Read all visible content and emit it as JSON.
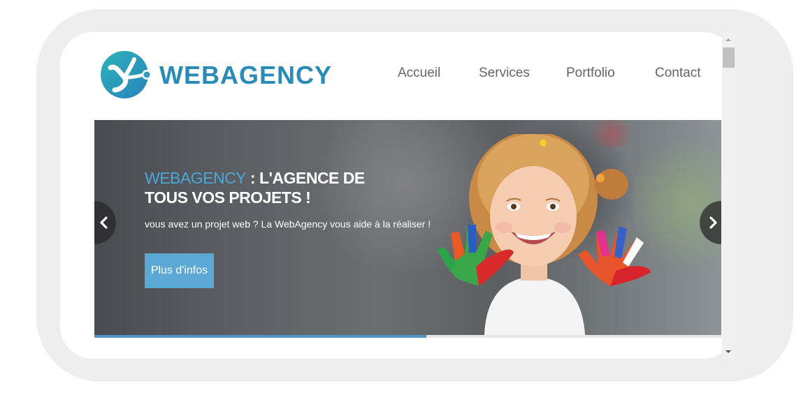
{
  "site": {
    "brand": "WEBAGENCY",
    "logo_icon": "webagency-logo-icon"
  },
  "nav": {
    "items": [
      {
        "label": "Accueil"
      },
      {
        "label": "Services"
      },
      {
        "label": "Portfolio"
      },
      {
        "label": "Contact"
      }
    ]
  },
  "hero": {
    "headline_accent": "WEBAGENCY",
    "headline_rest": " : L'AGENCE DE TOUS VOS PROJETS !",
    "subtitle": "vous avez un projet web ? La WebAgency vous aide à la réaliser !",
    "cta_label": "Plus d'infos",
    "image": "child-with-painted-hands-photo",
    "prev_icon": "chevron-left-icon",
    "next_icon": "chevron-right-icon"
  },
  "slider_progress": 0.53,
  "colors": {
    "brand": "#2a8ab8",
    "accent": "#4aa8d8",
    "cta": "#5ba8d4",
    "progress": "#4f96c6",
    "nav_text": "#666666"
  }
}
